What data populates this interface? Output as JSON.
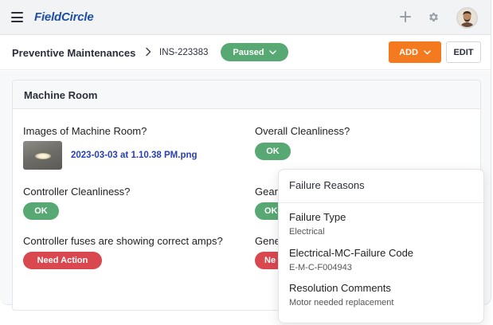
{
  "app": {
    "logo_text": "FieldCircle"
  },
  "header": {
    "breadcrumb": "Preventive Maintenances",
    "record_id": "INS-223383",
    "status": "Paused",
    "add_label": "ADD",
    "edit_label": "EDIT"
  },
  "section": {
    "title": "Machine Room",
    "fields": [
      {
        "label": "Images of Machine Room?",
        "file": "2023-03-03 at 1.10.38 PM.png"
      },
      {
        "label": "Overall Cleanliness?",
        "value": "OK"
      },
      {
        "label": "Controller Cleanliness?",
        "value": "OK"
      },
      {
        "label": "Gear",
        "value": "OK"
      },
      {
        "label": "Controller fuses are showing correct amps?",
        "value": "Need Action"
      },
      {
        "label": "Gene",
        "value": "Ne"
      }
    ]
  },
  "popover": {
    "title": "Failure Reasons",
    "items": [
      {
        "label": "Failure Type",
        "value": "Electrical"
      },
      {
        "label": "Electrical-MC-Failure Code",
        "value": "E-M-C-F004943"
      },
      {
        "label": "Resolution Comments",
        "value": "Motor needed replacement"
      }
    ]
  },
  "colors": {
    "brand_blue": "#1e4fa3",
    "status_green": "#58a873",
    "accent_orange": "#f47a1f",
    "alert_red": "#d9474f",
    "link_blue": "#2a3fb0"
  },
  "icons": [
    "menu-icon",
    "plus-icon",
    "gear-icon",
    "chevron-right-icon",
    "chevron-down-icon"
  ]
}
